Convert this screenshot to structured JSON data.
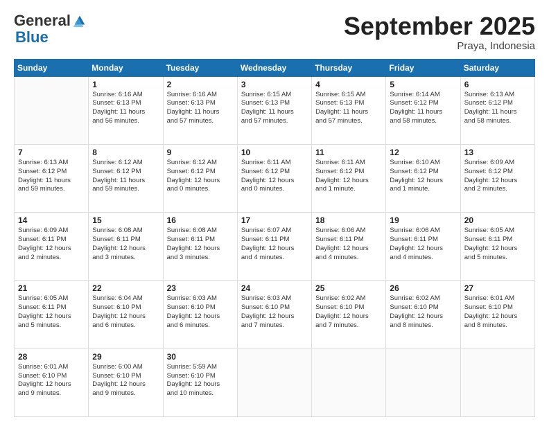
{
  "header": {
    "logo_general": "General",
    "logo_blue": "Blue",
    "month": "September 2025",
    "location": "Praya, Indonesia"
  },
  "weekdays": [
    "Sunday",
    "Monday",
    "Tuesday",
    "Wednesday",
    "Thursday",
    "Friday",
    "Saturday"
  ],
  "weeks": [
    [
      {
        "day": "",
        "info": ""
      },
      {
        "day": "1",
        "info": "Sunrise: 6:16 AM\nSunset: 6:13 PM\nDaylight: 11 hours\nand 56 minutes."
      },
      {
        "day": "2",
        "info": "Sunrise: 6:16 AM\nSunset: 6:13 PM\nDaylight: 11 hours\nand 57 minutes."
      },
      {
        "day": "3",
        "info": "Sunrise: 6:15 AM\nSunset: 6:13 PM\nDaylight: 11 hours\nand 57 minutes."
      },
      {
        "day": "4",
        "info": "Sunrise: 6:15 AM\nSunset: 6:13 PM\nDaylight: 11 hours\nand 57 minutes."
      },
      {
        "day": "5",
        "info": "Sunrise: 6:14 AM\nSunset: 6:12 PM\nDaylight: 11 hours\nand 58 minutes."
      },
      {
        "day": "6",
        "info": "Sunrise: 6:13 AM\nSunset: 6:12 PM\nDaylight: 11 hours\nand 58 minutes."
      }
    ],
    [
      {
        "day": "7",
        "info": "Sunrise: 6:13 AM\nSunset: 6:12 PM\nDaylight: 11 hours\nand 59 minutes."
      },
      {
        "day": "8",
        "info": "Sunrise: 6:12 AM\nSunset: 6:12 PM\nDaylight: 11 hours\nand 59 minutes."
      },
      {
        "day": "9",
        "info": "Sunrise: 6:12 AM\nSunset: 6:12 PM\nDaylight: 12 hours\nand 0 minutes."
      },
      {
        "day": "10",
        "info": "Sunrise: 6:11 AM\nSunset: 6:12 PM\nDaylight: 12 hours\nand 0 minutes."
      },
      {
        "day": "11",
        "info": "Sunrise: 6:11 AM\nSunset: 6:12 PM\nDaylight: 12 hours\nand 1 minute."
      },
      {
        "day": "12",
        "info": "Sunrise: 6:10 AM\nSunset: 6:12 PM\nDaylight: 12 hours\nand 1 minute."
      },
      {
        "day": "13",
        "info": "Sunrise: 6:09 AM\nSunset: 6:12 PM\nDaylight: 12 hours\nand 2 minutes."
      }
    ],
    [
      {
        "day": "14",
        "info": "Sunrise: 6:09 AM\nSunset: 6:11 PM\nDaylight: 12 hours\nand 2 minutes."
      },
      {
        "day": "15",
        "info": "Sunrise: 6:08 AM\nSunset: 6:11 PM\nDaylight: 12 hours\nand 3 minutes."
      },
      {
        "day": "16",
        "info": "Sunrise: 6:08 AM\nSunset: 6:11 PM\nDaylight: 12 hours\nand 3 minutes."
      },
      {
        "day": "17",
        "info": "Sunrise: 6:07 AM\nSunset: 6:11 PM\nDaylight: 12 hours\nand 4 minutes."
      },
      {
        "day": "18",
        "info": "Sunrise: 6:06 AM\nSunset: 6:11 PM\nDaylight: 12 hours\nand 4 minutes."
      },
      {
        "day": "19",
        "info": "Sunrise: 6:06 AM\nSunset: 6:11 PM\nDaylight: 12 hours\nand 4 minutes."
      },
      {
        "day": "20",
        "info": "Sunrise: 6:05 AM\nSunset: 6:11 PM\nDaylight: 12 hours\nand 5 minutes."
      }
    ],
    [
      {
        "day": "21",
        "info": "Sunrise: 6:05 AM\nSunset: 6:11 PM\nDaylight: 12 hours\nand 5 minutes."
      },
      {
        "day": "22",
        "info": "Sunrise: 6:04 AM\nSunset: 6:10 PM\nDaylight: 12 hours\nand 6 minutes."
      },
      {
        "day": "23",
        "info": "Sunrise: 6:03 AM\nSunset: 6:10 PM\nDaylight: 12 hours\nand 6 minutes."
      },
      {
        "day": "24",
        "info": "Sunrise: 6:03 AM\nSunset: 6:10 PM\nDaylight: 12 hours\nand 7 minutes."
      },
      {
        "day": "25",
        "info": "Sunrise: 6:02 AM\nSunset: 6:10 PM\nDaylight: 12 hours\nand 7 minutes."
      },
      {
        "day": "26",
        "info": "Sunrise: 6:02 AM\nSunset: 6:10 PM\nDaylight: 12 hours\nand 8 minutes."
      },
      {
        "day": "27",
        "info": "Sunrise: 6:01 AM\nSunset: 6:10 PM\nDaylight: 12 hours\nand 8 minutes."
      }
    ],
    [
      {
        "day": "28",
        "info": "Sunrise: 6:01 AM\nSunset: 6:10 PM\nDaylight: 12 hours\nand 9 minutes."
      },
      {
        "day": "29",
        "info": "Sunrise: 6:00 AM\nSunset: 6:10 PM\nDaylight: 12 hours\nand 9 minutes."
      },
      {
        "day": "30",
        "info": "Sunrise: 5:59 AM\nSunset: 6:10 PM\nDaylight: 12 hours\nand 10 minutes."
      },
      {
        "day": "",
        "info": ""
      },
      {
        "day": "",
        "info": ""
      },
      {
        "day": "",
        "info": ""
      },
      {
        "day": "",
        "info": ""
      }
    ]
  ]
}
